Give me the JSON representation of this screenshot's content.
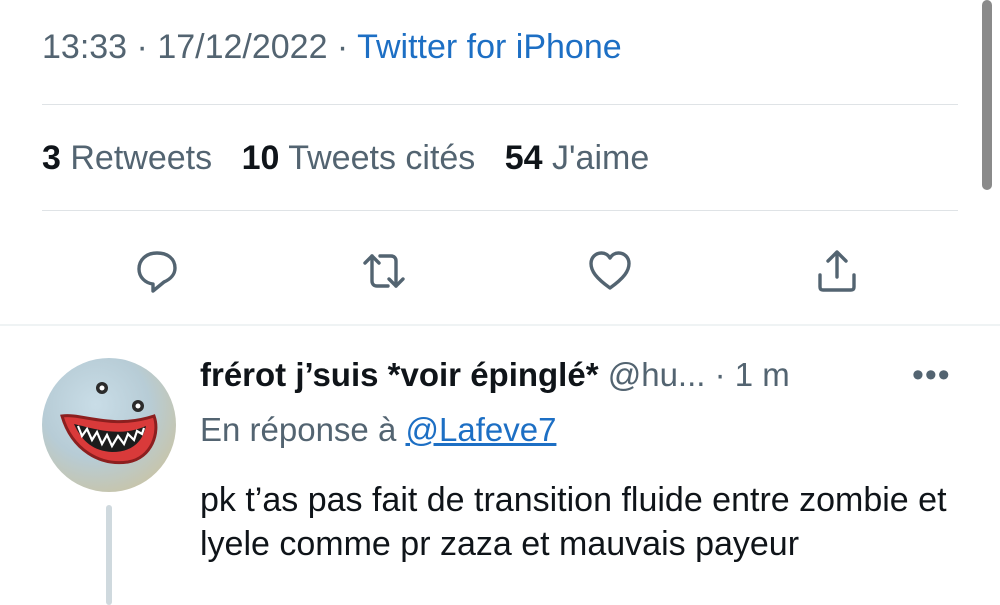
{
  "tweet_meta": {
    "time": "13:33",
    "date": "17/12/2022",
    "separator": " · ",
    "source": "Twitter for iPhone"
  },
  "stats": {
    "retweets": {
      "count": "3",
      "label": "Retweets"
    },
    "quotes": {
      "count": "10",
      "label": "Tweets cités"
    },
    "likes": {
      "count": "54",
      "label": "J'aime"
    }
  },
  "actions": [
    {
      "icon": "reply-icon"
    },
    {
      "icon": "retweet-icon"
    },
    {
      "icon": "like-icon"
    },
    {
      "icon": "share-icon"
    }
  ],
  "reply": {
    "display_name": "frérot j’suis *voir épinglé*",
    "handle": "@hu...",
    "dot": " · ",
    "time": "1 m",
    "more": "•••",
    "replying_to_label": "En réponse à",
    "replying_to_mention": "@Lafeve7",
    "text": "pk t’as pas fait de transition fluide entre zombie et lyele comme pr zaza et mauvais payeur"
  },
  "colors": {
    "link": "#1d6fc4",
    "secondary_text": "#536471",
    "primary_text": "#0f1419",
    "avatar_mouth": "#d93a3a"
  }
}
